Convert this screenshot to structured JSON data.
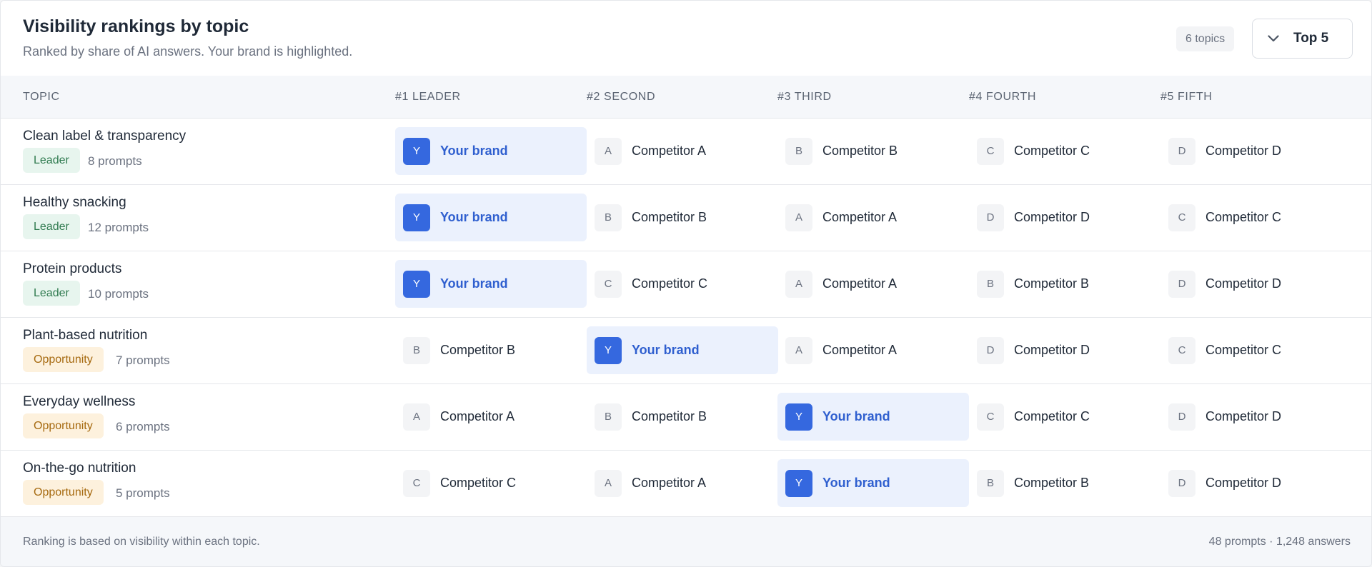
{
  "header": {
    "title": "Visibility rankings by topic",
    "subtitle": "Ranked by share of AI answers. Your brand is highlighted.",
    "topics_badge": "6 topics",
    "top_select": {
      "label": "Top 5",
      "icon": "chevron-down-icon"
    }
  },
  "table": {
    "columns": [
      "TOPIC",
      "#1  LEADER",
      "#2  SECOND",
      "#3  THIRD",
      "#4  FOURTH",
      "#5  FIFTH"
    ],
    "rows": [
      {
        "topic": "Clean label & transparency",
        "status": "Leader",
        "status_type": "leader",
        "prompts": "8 prompts",
        "ranks": [
          {
            "initial": "Y",
            "name": "Your brand",
            "own": true
          },
          {
            "initial": "A",
            "name": "Competitor A",
            "own": false
          },
          {
            "initial": "B",
            "name": "Competitor B",
            "own": false
          },
          {
            "initial": "C",
            "name": "Competitor C",
            "own": false
          },
          {
            "initial": "D",
            "name": "Competitor D",
            "own": false
          }
        ]
      },
      {
        "topic": "Healthy snacking",
        "status": "Leader",
        "status_type": "leader",
        "prompts": "12 prompts",
        "ranks": [
          {
            "initial": "Y",
            "name": "Your brand",
            "own": true
          },
          {
            "initial": "B",
            "name": "Competitor B",
            "own": false
          },
          {
            "initial": "A",
            "name": "Competitor A",
            "own": false
          },
          {
            "initial": "D",
            "name": "Competitor D",
            "own": false
          },
          {
            "initial": "C",
            "name": "Competitor C",
            "own": false
          }
        ]
      },
      {
        "topic": "Protein products",
        "status": "Leader",
        "status_type": "leader",
        "prompts": "10 prompts",
        "ranks": [
          {
            "initial": "Y",
            "name": "Your brand",
            "own": true
          },
          {
            "initial": "C",
            "name": "Competitor C",
            "own": false
          },
          {
            "initial": "A",
            "name": "Competitor A",
            "own": false
          },
          {
            "initial": "B",
            "name": "Competitor B",
            "own": false
          },
          {
            "initial": "D",
            "name": "Competitor D",
            "own": false
          }
        ]
      },
      {
        "topic": "Plant-based nutrition",
        "status": "Opportunity",
        "status_type": "opportunity",
        "prompts": "7 prompts",
        "ranks": [
          {
            "initial": "B",
            "name": "Competitor B",
            "own": false
          },
          {
            "initial": "Y",
            "name": "Your brand",
            "own": true
          },
          {
            "initial": "A",
            "name": "Competitor A",
            "own": false
          },
          {
            "initial": "D",
            "name": "Competitor D",
            "own": false
          },
          {
            "initial": "C",
            "name": "Competitor C",
            "own": false
          }
        ]
      },
      {
        "topic": "Everyday wellness",
        "status": "Opportunity",
        "status_type": "opportunity",
        "prompts": "6 prompts",
        "ranks": [
          {
            "initial": "A",
            "name": "Competitor A",
            "own": false
          },
          {
            "initial": "B",
            "name": "Competitor B",
            "own": false
          },
          {
            "initial": "Y",
            "name": "Your brand",
            "own": true
          },
          {
            "initial": "C",
            "name": "Competitor C",
            "own": false
          },
          {
            "initial": "D",
            "name": "Competitor D",
            "own": false
          }
        ]
      },
      {
        "topic": "On-the-go nutrition",
        "status": "Opportunity",
        "status_type": "opportunity",
        "prompts": "5 prompts",
        "ranks": [
          {
            "initial": "C",
            "name": "Competitor C",
            "own": false
          },
          {
            "initial": "A",
            "name": "Competitor A",
            "own": false
          },
          {
            "initial": "Y",
            "name": "Your brand",
            "own": true
          },
          {
            "initial": "B",
            "name": "Competitor B",
            "own": false
          },
          {
            "initial": "D",
            "name": "Competitor D",
            "own": false
          }
        ]
      }
    ]
  },
  "footer": {
    "note": "Ranking is based on visibility within each topic.",
    "stats": "48 prompts · 1,248 answers"
  },
  "colors": {
    "brand_accent": "#3568df",
    "brand_highlight": "#ebf1fd",
    "leader_bg": "#e7f5ee",
    "leader_text": "#2f7a4f",
    "opportunity_bg": "#fdf1dd",
    "opportunity_text": "#a66a10"
  }
}
